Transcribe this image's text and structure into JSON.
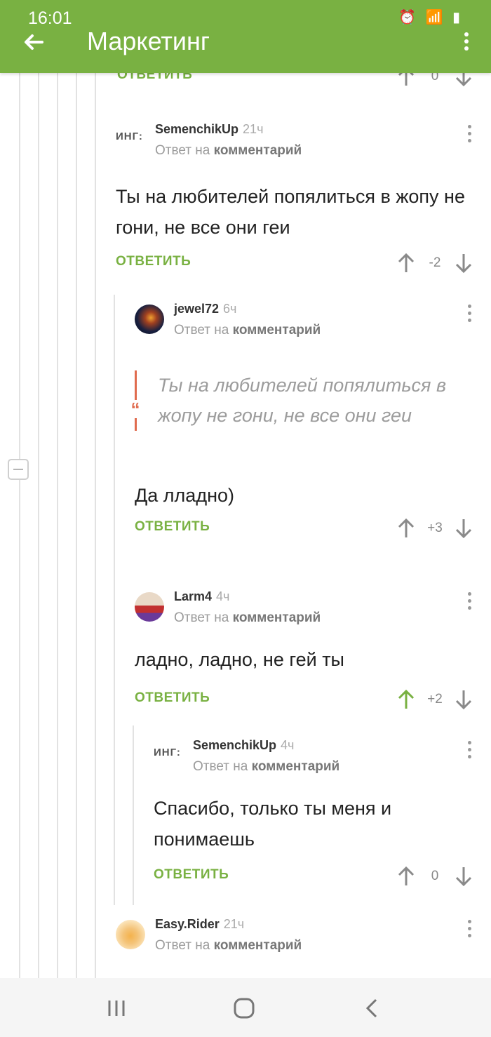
{
  "status_bar": {
    "time": "16:01",
    "icons": [
      "status-notification-icon",
      "alarm-icon",
      "wifi-icon",
      "signal-icon",
      "battery-icon"
    ]
  },
  "app_bar": {
    "title": "Маркетинг"
  },
  "colors": {
    "brand": "#79b142",
    "quote_accent": "#e06b4e",
    "upvoted": "#79b142"
  },
  "reply_label": "ОТВЕТИТЬ",
  "comments": [
    {
      "author": "",
      "time": "",
      "reply_prefix": "",
      "reply_link": "",
      "text": "",
      "score": "0"
    },
    {
      "avatar_text": "ИНГ:",
      "author": "SemenchikUp",
      "time": "21ч",
      "reply_prefix": "Ответ на ",
      "reply_link": "комментарий",
      "text": "Ты на любителей попялиться в жопу не гони, не все они геи",
      "score": "-2"
    },
    {
      "author": "jewel72",
      "time": "6ч",
      "reply_prefix": "Ответ на ",
      "reply_link": "комментарий",
      "quote": "Ты на любителей попялиться в жопу не гони, не все они геи",
      "quote_mark": "“",
      "text": "Да лладно)",
      "score": "+3"
    },
    {
      "author": "Larm4",
      "time": "4ч",
      "reply_prefix": "Ответ на ",
      "reply_link": "комментарий",
      "text": "ладно, ладно, не гей ты",
      "score": "+2",
      "upvoted": true
    },
    {
      "avatar_text": "ИНГ:",
      "author": "SemenchikUp",
      "time": "4ч",
      "reply_prefix": "Ответ на ",
      "reply_link": "комментарий",
      "text": "Спасибо, только ты меня и понимаешь",
      "score": "0"
    },
    {
      "author": "Easy.Rider",
      "time": "21ч",
      "reply_prefix": "Ответ на ",
      "reply_link": "комментарий",
      "text": ""
    }
  ],
  "nav_bar": {
    "buttons": [
      "recent-apps-icon",
      "home-icon",
      "back-icon"
    ]
  }
}
